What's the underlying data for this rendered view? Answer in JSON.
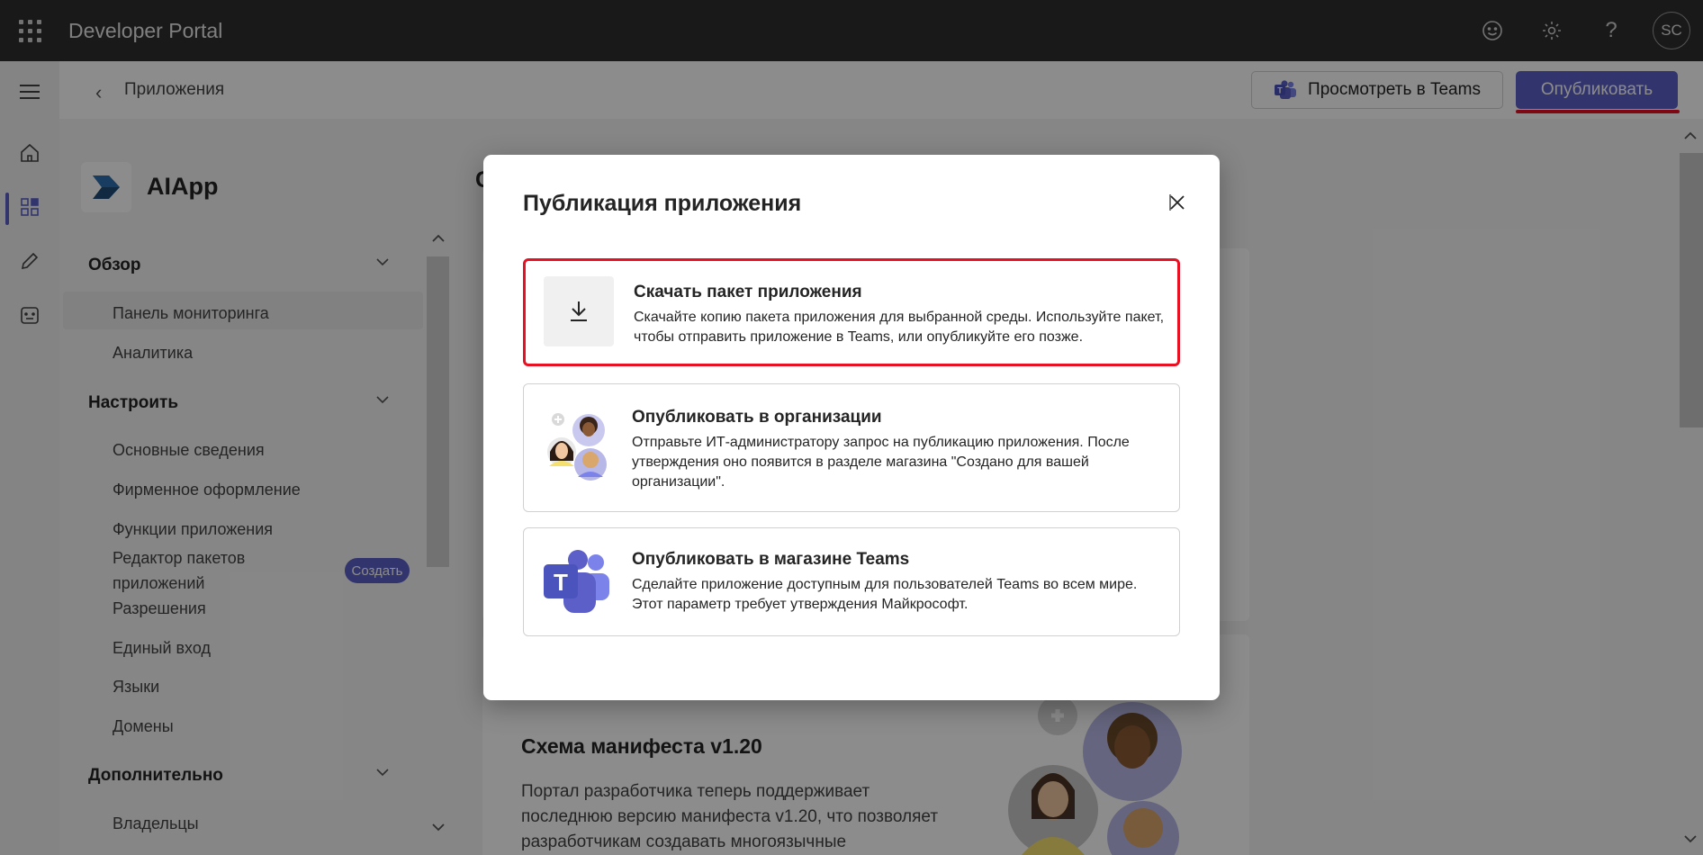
{
  "topbar": {
    "title": "Developer Portal",
    "avatar_initials": "SC"
  },
  "header": {
    "breadcrumb": "Приложения",
    "view_in_teams": "Просмотреть в Teams",
    "publish": "Опубликовать"
  },
  "app": {
    "name": "AIApp"
  },
  "nav": {
    "overview": {
      "label": "Обзор",
      "items": [
        "Панель мониторинга",
        "Аналитика"
      ]
    },
    "configure": {
      "label": "Настроить",
      "items": [
        "Основные сведения",
        "Фирменное оформление",
        "Функции приложения",
        "Редактор пакетов приложений",
        "Разрешения",
        "Единый вход",
        "Языки",
        "Домены"
      ]
    },
    "advanced": {
      "label": "Дополнительно",
      "items": [
        "Владельцы"
      ]
    },
    "create_badge": "Создать"
  },
  "main": {
    "heading_initial": "С",
    "manifest_title": "Схема манифеста v1.20",
    "manifest_body": "Портал разработчика теперь поддерживает последнюю версию манифеста v1.20, что позволяет разработчикам создавать многоязычные"
  },
  "modal": {
    "title": "Публикация приложения",
    "options": [
      {
        "title": "Скачать пакет приложения",
        "desc": "Скачайте копию пакета приложения для выбранной среды. Используйте пакет, чтобы отправить приложение в Teams, или опубликуйте его позже.",
        "icon": "download-icon"
      },
      {
        "title": "Опубликовать в организации",
        "desc": "Отправьте ИТ-администратору запрос на публикацию приложения. После утверждения оно появится в разделе магазина \"Создано для вашей организации\".",
        "icon": "people-illustration-icon"
      },
      {
        "title": "Опубликовать в магазине Teams",
        "desc": "Сделайте приложение доступным для пользователей Teams во всем мире. Этот параметр требует утверждения Майкрософт.",
        "icon": "teams-logo-icon"
      }
    ]
  },
  "colors": {
    "accent": "#5b5fc7",
    "highlight": "#e81123",
    "topbar": "#2e2e2e"
  }
}
